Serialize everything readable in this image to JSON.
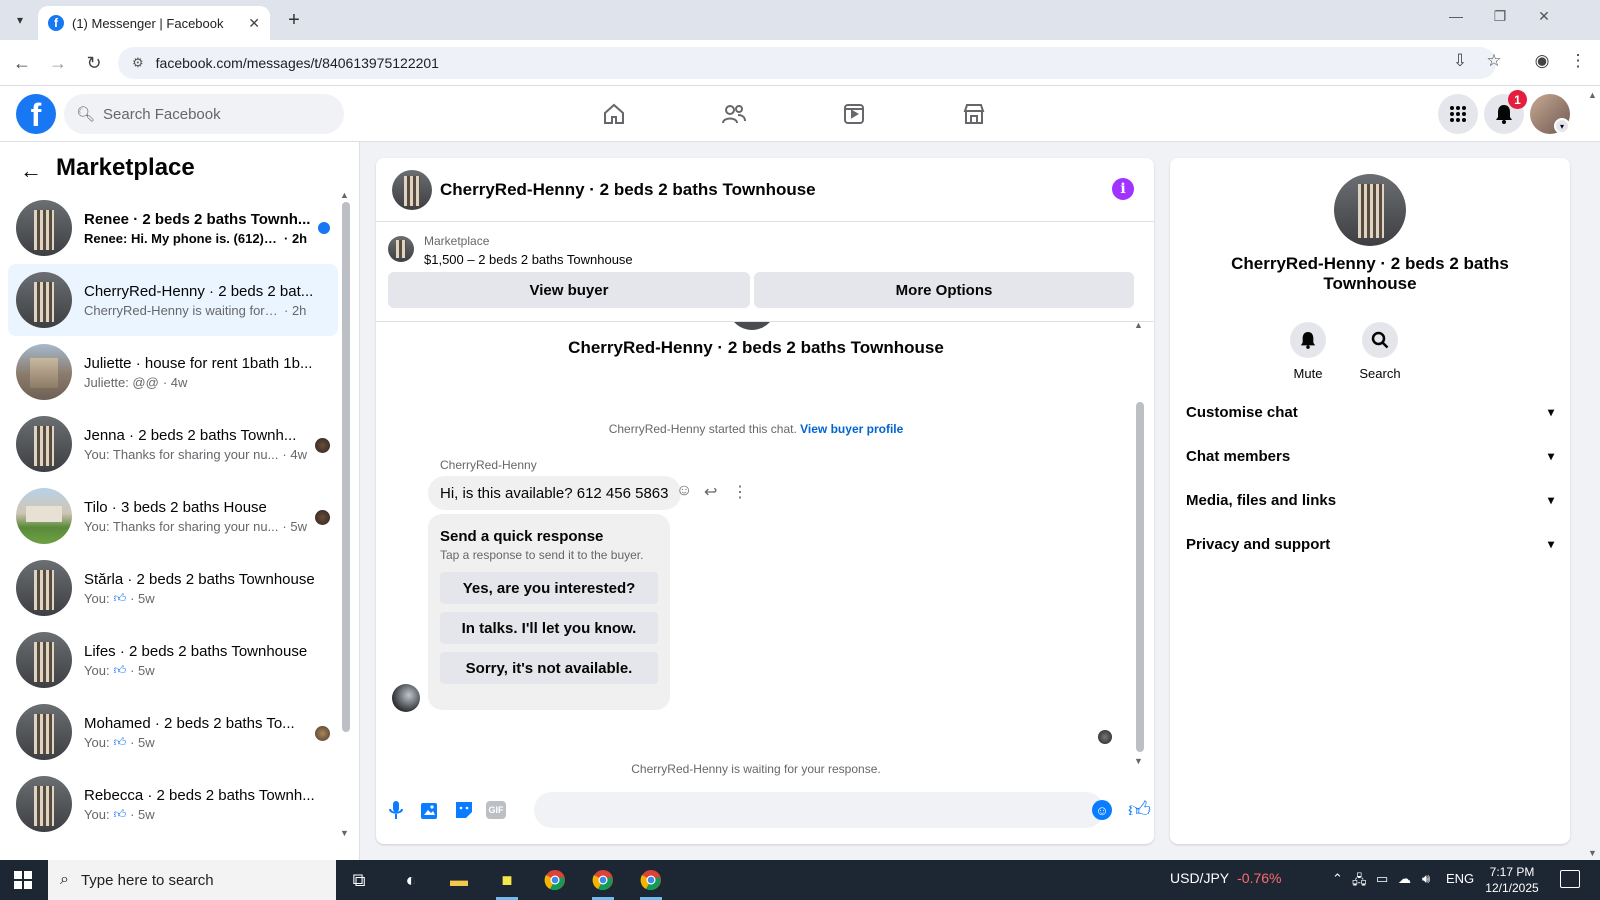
{
  "browser": {
    "tab_title": "(1) Messenger | Facebook",
    "url": "facebook.com/messages/t/840613975122201"
  },
  "fb": {
    "search_placeholder": "Search Facebook",
    "notification_count": "1"
  },
  "sidebar": {
    "title": "Marketplace",
    "conversations": [
      {
        "name": "Renee · 2 beds 2 baths Townh...",
        "preview": "Renee: Hi. My phone is. (612) 46...",
        "time": "· 2h",
        "unread": true
      },
      {
        "name": "CherryRed-Henny · 2 beds 2 bat...",
        "preview": "CherryRed-Henny is waiting for yo...",
        "time": "· 2h",
        "active": true
      },
      {
        "name": "Juliette · house for rent 1bath 1b...",
        "preview": "Juliette: @@",
        "time": "· 4w"
      },
      {
        "name": "Jenna · 2 beds 2 baths Townh...",
        "preview": "You: Thanks for sharing your nu...",
        "time": "· 4w"
      },
      {
        "name": "Tilo · 3 beds 2 baths House",
        "preview": "You: Thanks for sharing your nu...",
        "time": "· 5w"
      },
      {
        "name": "Stărla · 2 beds 2 baths Townhouse",
        "preview": "You:",
        "time": "· 5w"
      },
      {
        "name": "Lifes · 2 beds 2 baths Townhouse",
        "preview": "You:",
        "time": "· 5w"
      },
      {
        "name": "Mohamed · 2 beds 2 baths To...",
        "preview": "You:",
        "time": "· 5w"
      },
      {
        "name": "Rebecca · 2 beds 2 baths Townh...",
        "preview": "You:",
        "time": "· 5w"
      }
    ]
  },
  "chat": {
    "title": "CherryRed-Henny · 2 beds 2 baths Townhouse",
    "marketplace_label": "Marketplace",
    "listing": "$1,500 – 2 beds 2 baths Townhouse",
    "view_buyer": "View buyer",
    "more_options": "More Options",
    "heading": "CherryRed-Henny · 2 beds 2 baths Townhouse",
    "started_text": "CherryRed-Henny started this chat.",
    "view_buyer_profile": "View buyer profile",
    "sender": "CherryRed-Henny",
    "message": "Hi, is this available? 612 456 5863",
    "quick_title": "Send a quick response",
    "quick_sub": "Tap a response to send it to the buyer.",
    "quick_responses": [
      "Yes, are you interested?",
      "In talks. I'll let you know.",
      "Sorry, it's not available."
    ],
    "waiting": "CherryRed-Henny is waiting for your response.",
    "composer_placeholder": ""
  },
  "info": {
    "name": "CherryRed-Henny · 2 beds 2 baths Townhouse",
    "mute": "Mute",
    "search": "Search",
    "rows": [
      "Customise chat",
      "Chat members",
      "Media, files and links",
      "Privacy and support"
    ]
  },
  "taskbar": {
    "search_placeholder": "Type here to search",
    "ticker_label": "USD/JPY",
    "ticker_change": "-0.76%",
    "lang": "ENG",
    "time": "7:17 PM",
    "date": "12/1/2025"
  },
  "colors": {
    "fb_blue": "#1877f2",
    "messenger_blue": "#0a7cff",
    "info_purple": "#a033ff",
    "badge_red": "#e41e3f"
  }
}
